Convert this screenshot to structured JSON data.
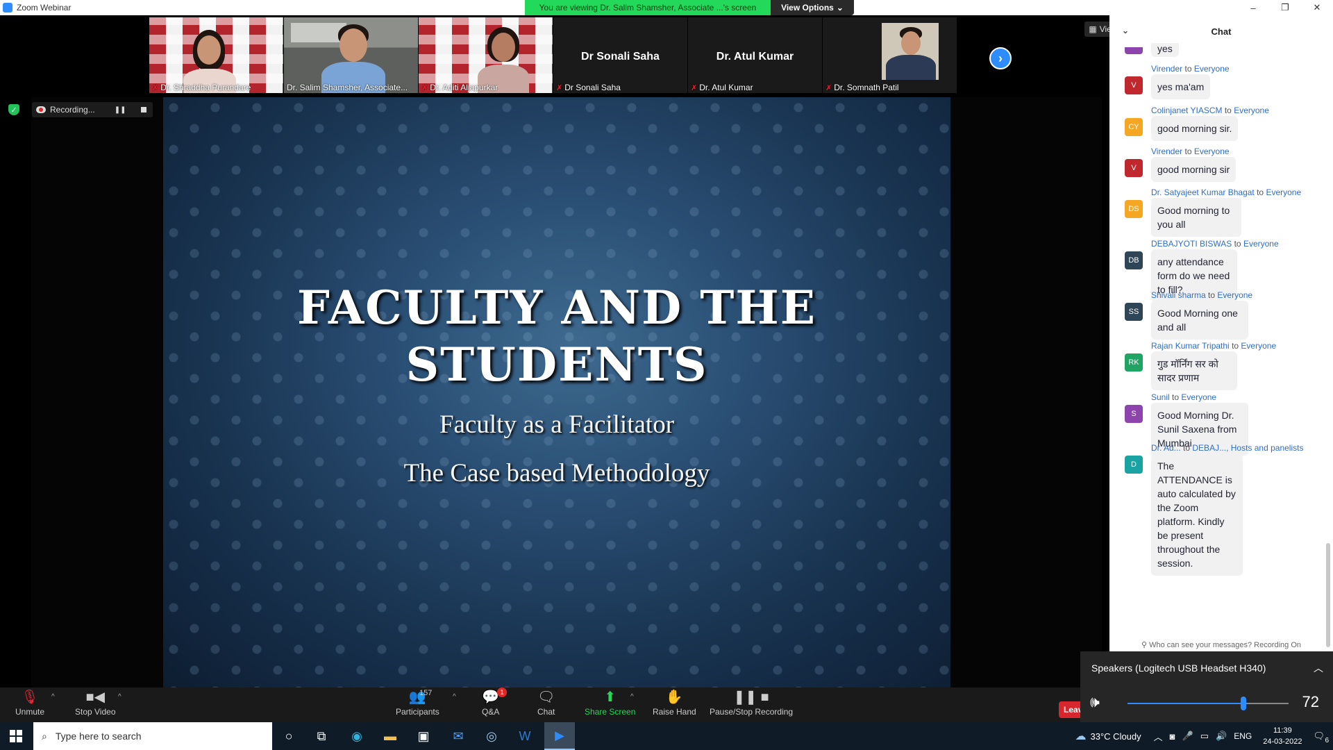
{
  "window": {
    "title": "Zoom Webinar",
    "viewing_banner": "You are viewing Dr. Salim Shamsher, Associate ...'s screen",
    "view_options": "View Options",
    "controls": [
      "–",
      "❐",
      "✕"
    ]
  },
  "gallery": {
    "view_label": "View",
    "tiles": [
      {
        "name": "Dr. Shraddha Purandare",
        "video": true
      },
      {
        "name": "Dr. Salim Shamsher, Associate...",
        "video": true,
        "active": true
      },
      {
        "name": "Dr. Aditi Aljapurkar",
        "video": true
      },
      {
        "name": "Dr Sonali Saha",
        "big_name": "Dr Sonali Saha",
        "video": false
      },
      {
        "name": "Dr. Atul Kumar",
        "big_name": "Dr. Atul Kumar",
        "video": false
      },
      {
        "name": "Dr. Somnath Patil",
        "video": false,
        "photo": true
      }
    ]
  },
  "recording": {
    "label": "Recording..."
  },
  "slide": {
    "title_line1": "FACULTY AND THE",
    "title_line2": "STUDENTS",
    "subtitle1": "Faculty as a Facilitator",
    "subtitle2": "The Case based Methodology"
  },
  "chat": {
    "title": "Chat",
    "partial_top": "yes",
    "messages": [
      {
        "from": "Virender",
        "to": "Everyone",
        "initials": "V",
        "color": "#c0282d",
        "text": "yes ma'am"
      },
      {
        "from": "Colinjanet YIASCM",
        "to": "Everyone",
        "initials": "CY",
        "color": "#f5a623",
        "text": "good morning sir."
      },
      {
        "from": "Virender",
        "to": "Everyone",
        "initials": "V",
        "color": "#c0282d",
        "text": "good morning sir"
      },
      {
        "from": "Dr. Satyajeet Kumar Bhagat",
        "to": "Everyone",
        "initials": "DS",
        "color": "#f5a623",
        "text": "Good morning to you all"
      },
      {
        "from": "DEBAJYOTI BISWAS",
        "to": "Everyone",
        "initials": "DB",
        "color": "#2f4656",
        "text": "any attendance form do we need to fill?"
      },
      {
        "from": "Shivali sharma",
        "to": "Everyone",
        "initials": "SS",
        "color": "#2f4656",
        "text": "Good Morning one and all"
      },
      {
        "from": "Rajan Kumar Tripathi",
        "to": "Everyone",
        "initials": "RK",
        "color": "#1fa463",
        "text": "गुड मॉर्निंग सर को सादर प्रणाम"
      },
      {
        "from": "Sunil",
        "to": "Everyone",
        "initials": "S",
        "color": "#8e44ad",
        "text": "Good Morning Dr. Sunil Saxena from Mumbai"
      },
      {
        "from": "Dr. Ad...",
        "to": "DEBAJ..., Hosts and panelists",
        "initials": "D",
        "color": "#1aa3a3",
        "text": "The ATTENDANCE is auto calculated by the Zoom platform. Kindly be present throughout the session."
      }
    ],
    "to_word": "to",
    "footer": "Who can see your messages? Recording On"
  },
  "speaker": {
    "device": "Speakers (Logitech USB Headset H340)",
    "volume": 72,
    "volume_fraction": 0.72
  },
  "toolbar": {
    "unmute": "Unmute",
    "stop_video": "Stop Video",
    "participants": "Participants",
    "participants_count": "157",
    "qa": "Q&A",
    "qa_badge": "1",
    "chat": "Chat",
    "share_screen": "Share Screen",
    "raise_hand": "Raise Hand",
    "pause_stop": "Pause/Stop Recording",
    "leave": "Leave"
  },
  "taskbar": {
    "search_placeholder": "Type here to search",
    "weather": "33°C  Cloudy",
    "lang": "ENG",
    "time": "11:39",
    "date": "24-03-2022",
    "notifications": "6"
  }
}
